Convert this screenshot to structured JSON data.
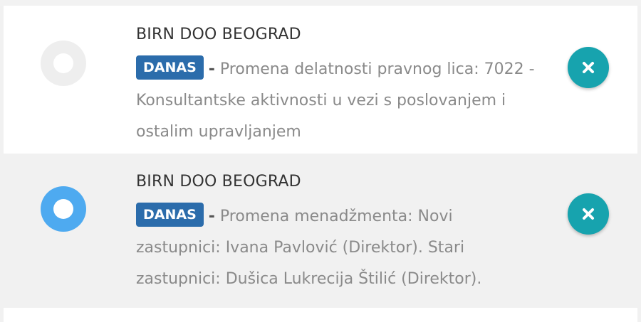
{
  "notifications": [
    {
      "company": "BIRN DOO BEOGRAD",
      "badge": "DANAS",
      "separator": "-",
      "line1": "Promena delatnosti pravnog lica: 7022 -",
      "line2": "Konsultantske aktivnosti u vezi s poslovanjem i",
      "line3": "ostalim upravljanjem",
      "selected": false
    },
    {
      "company": "BIRN DOO BEOGRAD",
      "badge": "DANAS",
      "separator": "-",
      "line1": "Promena menadžmenta: Novi",
      "line2": "zastupnici: Ivana Pavlović (Direktor). Stari",
      "line3": "zastupnici: Dušica Lukrecija Štilić (Direktor).",
      "selected": true
    }
  ],
  "colors": {
    "badge": "#2b6cab",
    "radio_selected": "#4eaaf0",
    "radio_unselected": "#eeeeee",
    "close_button": "#17a3ae"
  },
  "icons": {
    "radio": "radio-icon",
    "close": "close-icon"
  }
}
